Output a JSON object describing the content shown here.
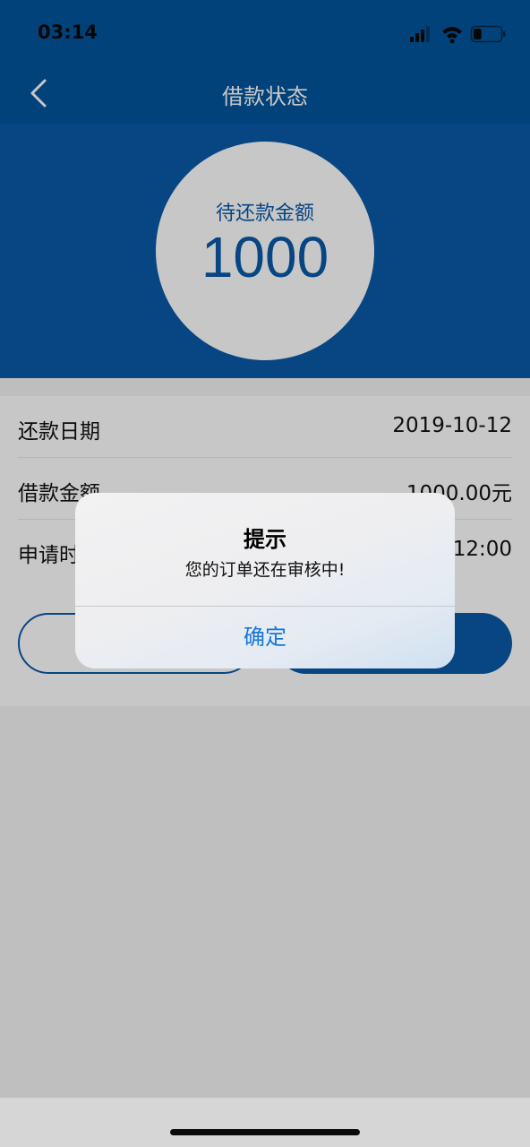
{
  "status_bar": {
    "time": "03:14",
    "battery_level": 0.3
  },
  "nav": {
    "title": "借款状态",
    "back_icon": "chevron-left-icon"
  },
  "hero": {
    "label": "待还款金额",
    "amount": "1000"
  },
  "info": {
    "rows": [
      {
        "label": "还款日期",
        "value": "2019-10-12"
      },
      {
        "label": "借款金额",
        "value": "1000.00元"
      },
      {
        "label": "申请时",
        "value": "12:00"
      }
    ]
  },
  "dialog": {
    "title": "提示",
    "message": "您的订单还在审核中!",
    "confirm_label": "确定"
  },
  "colors": {
    "primary": "#0a5aa8",
    "nav_bg": "#02559d",
    "dialog_button": "#1677d8"
  }
}
